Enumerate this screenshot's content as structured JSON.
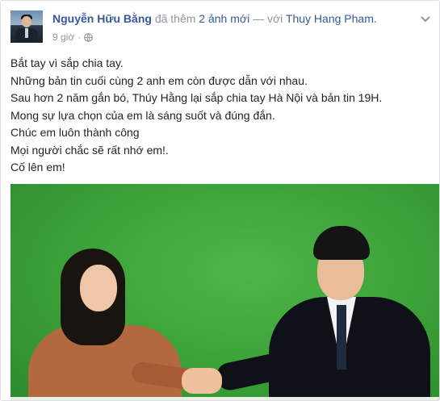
{
  "header": {
    "author": "Nguyễn Hữu Bằng",
    "action_prefix": "đã thêm",
    "photos_link": "2 ảnh mới",
    "separator": "— với",
    "tagged": "Thuy Hang Pham.",
    "time": "9 giờ",
    "dot": "·",
    "privacy_icon": "globe-icon",
    "options_icon": "chevron-down-icon"
  },
  "post": {
    "lines": [
      "Bắt tay vì sắp chia tay.",
      "Những bản tin cuối cùng 2 anh em còn được dẫn với nhau.",
      "Sau hơn 2 năm gắn bó, Thúy Hằng lại sắp chia tay Hà Nội và bản tin 19H.",
      "Mong sự lựa chọn của em là sáng suốt và đúng đắn.",
      "Chúc em luôn thành công",
      "Mọi người chắc sẽ rất nhớ em!.",
      "Cố lên em!"
    ]
  },
  "colors": {
    "link": "#365899",
    "meta": "#90949c",
    "text": "#1d2129",
    "photo_bg": "#3ea53a"
  }
}
